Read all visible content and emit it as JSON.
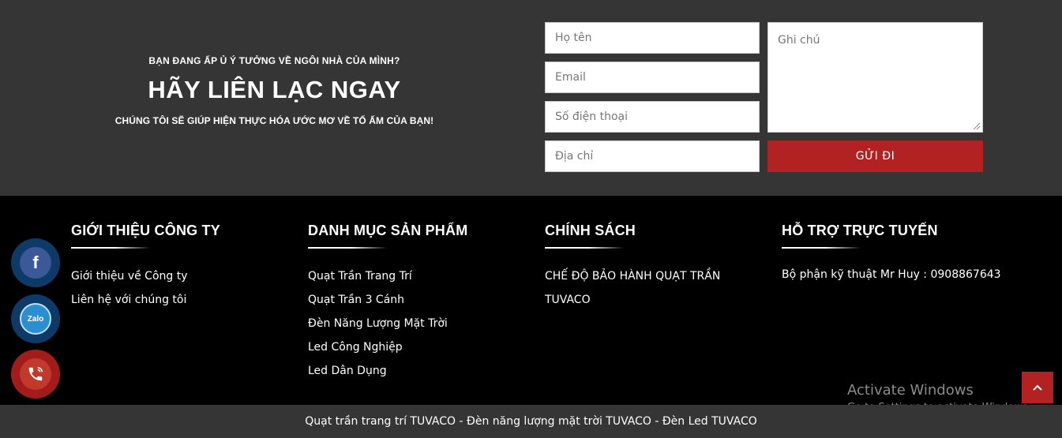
{
  "contact": {
    "kicker": "BẠN ĐANG ẤP Ủ Ý TƯỞNG VỀ NGÔI NHÀ CỦA MÌNH?",
    "headline": "HÃY LIÊN LẠC NGAY",
    "subline": "CHÚNG TÔI SẼ GIÚP HIỆN THỰC HÓA ƯỚC MƠ VỀ TỔ ẤM CỦA BẠN!",
    "form": {
      "name_placeholder": "Họ tên",
      "email_placeholder": "Email",
      "phone_placeholder": "Số điện thoại",
      "address_placeholder": "Địa chỉ",
      "note_placeholder": "Ghi chú",
      "submit_label": "GỬI ĐI"
    }
  },
  "footer": {
    "columns": [
      {
        "title": "GIỚI THIỆU CÔNG TY",
        "items": [
          "Giới thiệu về Công ty",
          "Liên hệ với chúng tôi"
        ]
      },
      {
        "title": "DANH MỤC SẢN PHẨM",
        "items": [
          "Quạt Trần Trang Trí",
          "Quạt Trần 3 Cánh",
          "Đèn Năng Lượng Mặt Trời",
          "Led Công Nghiệp",
          "Led Dân Dụng"
        ]
      },
      {
        "title": "CHÍNH SÁCH",
        "items": [
          "CHẾ ĐỘ BẢO HÀNH QUẠT TRẦN TUVACO"
        ]
      },
      {
        "title": "HỖ TRỢ TRỰC TUYẾN",
        "items": [
          "Bộ phận kỹ thuật Mr Huy : 0908867643"
        ]
      }
    ]
  },
  "floating": {
    "facebook_glyph": "f",
    "zalo_label": "Zalo"
  },
  "watermark": {
    "line1": "Activate Windows",
    "line2": "Go to Settings to activate Windows."
  },
  "bottom_bar": {
    "text": "Quạt trần trang trí TUVACO - Đèn năng lượng mặt trời TUVACO - Đèn Led TUVACO"
  },
  "colors": {
    "accent_red": "#b22222",
    "section_gray": "#353535",
    "facebook_blue": "#3b5998",
    "zalo_blue": "#2a8fd1"
  }
}
